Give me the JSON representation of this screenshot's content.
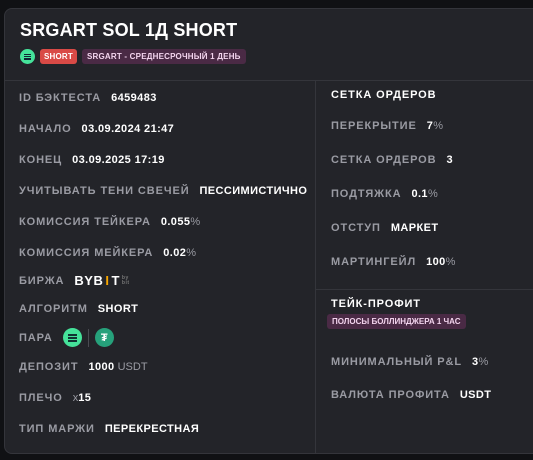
{
  "header": {
    "title": "SRGART SOL 1Д SHORT",
    "badge_short": "SHORT",
    "badge_strategy": "SRGART - СРЕДНЕСРОЧНЫЙ 1 ДЕНЬ"
  },
  "left": {
    "backtest_id": {
      "label": "ID БЭКТЕСТА",
      "value": "6459483"
    },
    "start": {
      "label": "НАЧАЛО",
      "value": "03.09.2024 21:47"
    },
    "end": {
      "label": "КОНЕЦ",
      "value": "03.09.2025 17:19"
    },
    "wicks": {
      "label": "УЧИТЫВАТЬ ТЕНИ СВЕЧЕЙ",
      "value": "ПЕССИМИСТИЧНО"
    },
    "taker_fee": {
      "label": "КОМИССИЯ ТЕЙКЕРА",
      "value": "0.055",
      "unit": "%"
    },
    "maker_fee": {
      "label": "КОМИССИЯ МЕЙКЕРА",
      "value": "0.02",
      "unit": "%"
    },
    "exchange": {
      "label": "БИРЖА",
      "logo": "BYBIT"
    },
    "algorithm": {
      "label": "АЛГОРИТМ",
      "value": "SHORT"
    },
    "pair": {
      "label": "ПАРА",
      "icons": [
        "sol-icon",
        "usdt-icon"
      ]
    },
    "deposit": {
      "label": "ДЕПОЗИТ",
      "value": "1000",
      "unit": "USDT"
    },
    "leverage": {
      "label": "ПЛЕЧО",
      "unit": "x",
      "value": "15"
    },
    "margin_type": {
      "label": "ТИП МАРЖИ",
      "value": "ПЕРЕКРЕСТНАЯ"
    }
  },
  "orders": {
    "section_title": "СЕТКА ОРДЕРОВ",
    "overlap": {
      "label": "ПЕРЕКРЫТИЕ",
      "value": "7",
      "unit": "%"
    },
    "grid": {
      "label": "СЕТКА ОРДЕРОВ",
      "value": "3"
    },
    "pullup": {
      "label": "ПОДТЯЖКА",
      "value": "0.1",
      "unit": "%"
    },
    "offset": {
      "label": "ОТСТУП",
      "value": "МАРКЕТ"
    },
    "martingale": {
      "label": "МАРТИНГЕЙЛ",
      "value": "100",
      "unit": "%"
    }
  },
  "takeprofit": {
    "section_title": "ТЕЙК-ПРОФИТ",
    "badge": "ПОЛОСЫ БОЛЛИНДЖЕРА 1 ЧАС",
    "min_pnl": {
      "label": "МИНИМАЛЬНЫЙ P&L",
      "value": "3",
      "unit": "%"
    },
    "currency": {
      "label": "ВАЛЮТА ПРОФИТА",
      "value": "USDT"
    }
  },
  "colors": {
    "accent_short": "#d94a46",
    "strategy_badge": "#4a2a45",
    "sol": "#45e29a",
    "usdt": "#26a17b",
    "bybit": "#f7a600"
  }
}
